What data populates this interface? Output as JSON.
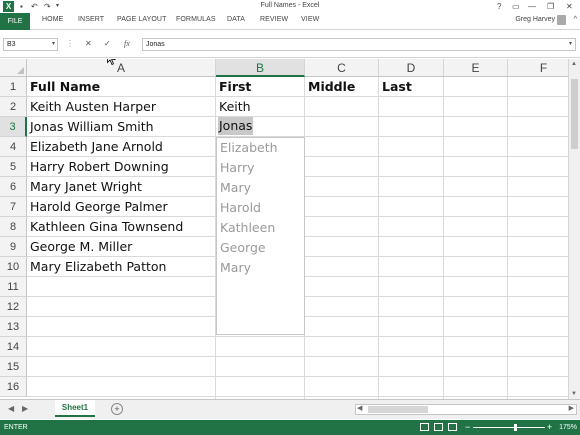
{
  "window": {
    "title": "Full Names - Excel",
    "app_icon": "X",
    "undo_icon": "↶",
    "redo_icon": "↷",
    "help": "?",
    "restore_ribbon": "▭",
    "minimize": "—",
    "maximize": "❐",
    "close": "✕"
  },
  "ribbon": {
    "tabs": [
      "FILE",
      "HOME",
      "INSERT",
      "PAGE LAYOUT",
      "FORMULAS",
      "DATA",
      "REVIEW",
      "VIEW"
    ],
    "user": "Greg Harvey",
    "collapse": "^"
  },
  "formula_bar": {
    "name_box": "B3",
    "dropdown": "▾",
    "separator": "⋮",
    "cancel": "✕",
    "enter": "✓",
    "fx": "fx",
    "value": "Jonas"
  },
  "grid": {
    "columns": [
      "A",
      "B",
      "C",
      "D",
      "E",
      "F"
    ],
    "rows": [
      "1",
      "2",
      "3",
      "4",
      "5",
      "6",
      "7",
      "8",
      "9",
      "10",
      "11",
      "12",
      "13",
      "14",
      "15",
      "16"
    ],
    "headers": {
      "a": "Full Name",
      "b": "First",
      "c": "Middle",
      "d": "Last"
    },
    "full_names": [
      "Keith Austen Harper",
      "Jonas William Smith",
      "Elizabeth Jane Arnold",
      "Harry Robert Downing",
      "Mary Janet Wright",
      "Harold George Palmer",
      "Kathleen Gina Townsend",
      "George M. Miller",
      "Mary Elizabeth Patton"
    ],
    "first_b2": "Keith",
    "active_cell_value": "Jonas",
    "flash_fill_suggestions": [
      "Elizabeth",
      "Harry",
      "Mary",
      "Harold",
      "Kathleen",
      "George",
      "Mary"
    ]
  },
  "sheets": {
    "nav_prev": "◀",
    "nav_next": "▶",
    "active": "Sheet1",
    "add": "+"
  },
  "status": {
    "mode": "ENTER",
    "zoom_minus": "−",
    "zoom_plus": "+",
    "zoom": "175%"
  },
  "colors": {
    "accent": "#217346",
    "suggestion": "#9a9a9a"
  }
}
